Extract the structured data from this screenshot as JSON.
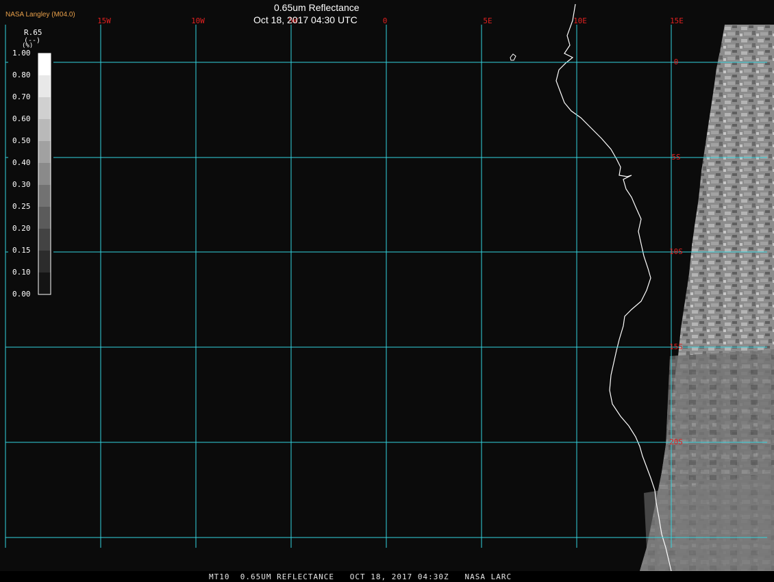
{
  "header": {
    "title": "0.65um Reflectance",
    "timestamp": "Oct 18, 2017 04:30 UTC",
    "producer": "NASA Langley (M04.0)"
  },
  "footer": {
    "caption": "MT10  0.65UM REFLECTANCE   OCT 18, 2017 04:30Z   NASA LARC"
  },
  "legend": {
    "title": "R.65",
    "unit": "(--)",
    "unit_prefix": "(%)",
    "ticks": [
      "1.00",
      "0.80",
      "0.70",
      "0.60",
      "0.50",
      "0.40",
      "0.30",
      "0.25",
      "0.20",
      "0.15",
      "0.10",
      "0.00"
    ]
  },
  "grid": {
    "longitude_labels": [
      "15W",
      "10W",
      "5W",
      "0",
      "5E",
      "10E",
      "15E"
    ],
    "latitude_labels": [
      "0",
      "5S",
      "10S",
      "15S",
      "20S"
    ],
    "line_color": "#33d6e0",
    "label_color": "#e02020"
  },
  "colors": {
    "background": "#0b0b0b",
    "coastline": "#ffffff"
  }
}
